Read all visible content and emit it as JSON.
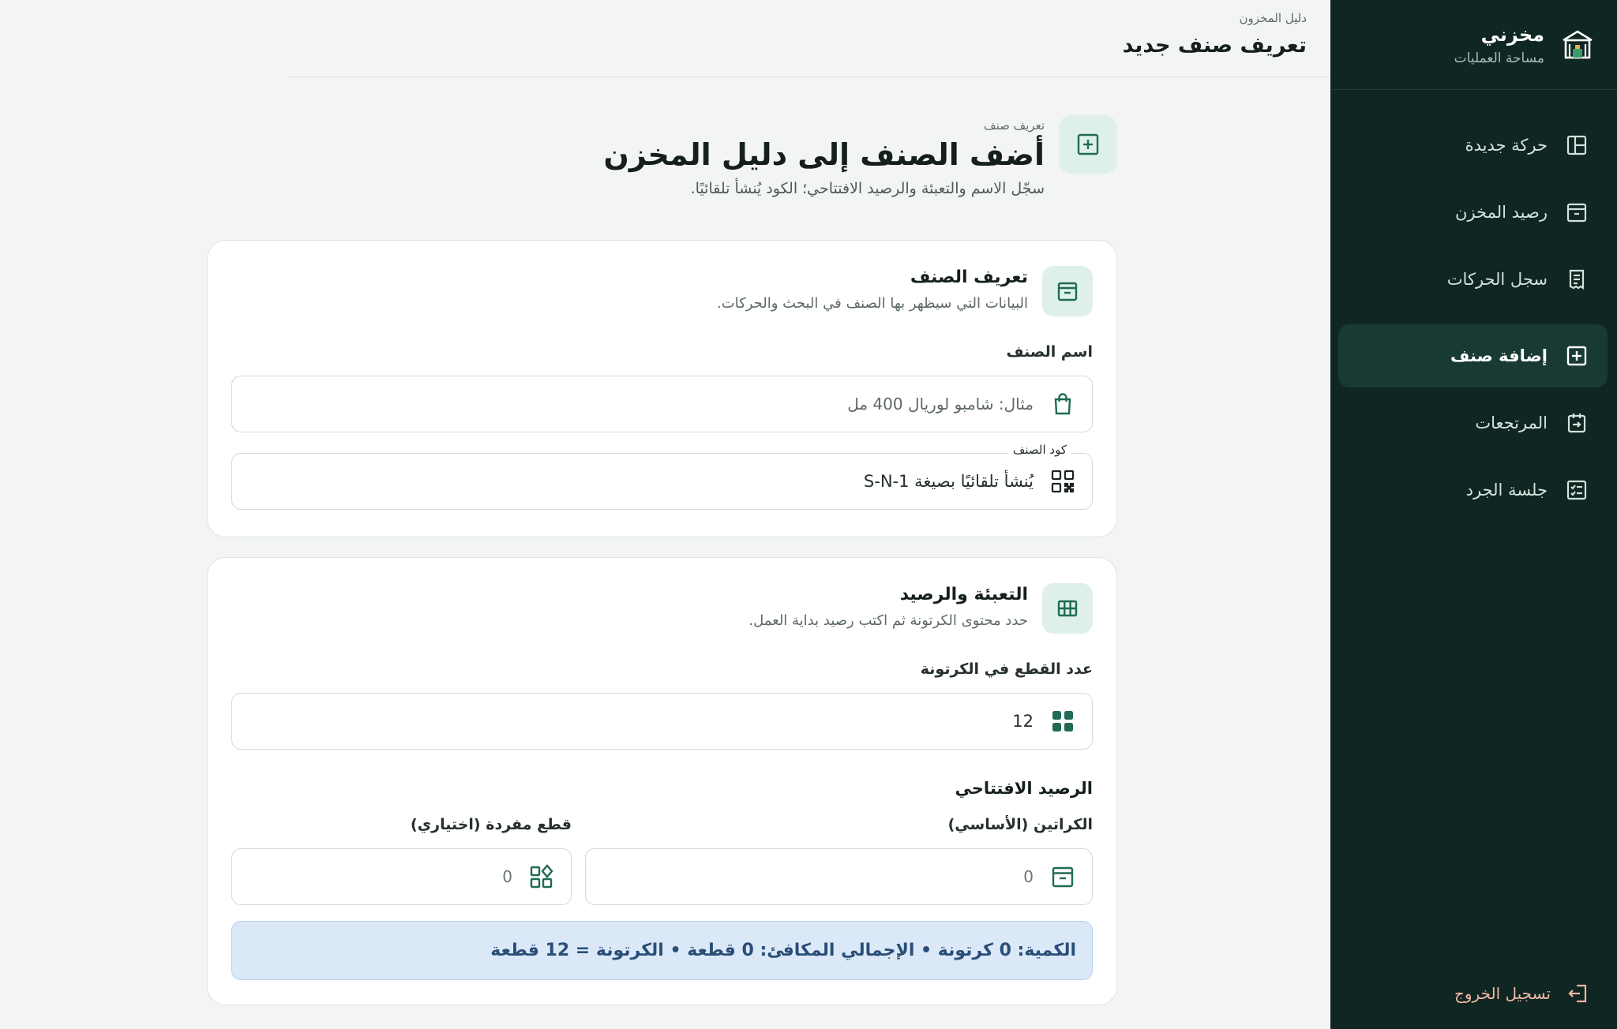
{
  "sidebar": {
    "brand_name": "مخزني",
    "brand_sub": "مساحة العمليات",
    "items": [
      {
        "label": "حركة جديدة",
        "icon": "layout-icon"
      },
      {
        "label": "رصيد المخزن",
        "icon": "archive-icon"
      },
      {
        "label": "سجل الحركات",
        "icon": "receipt-icon"
      },
      {
        "label": "إضافة صنف",
        "icon": "plus-square-icon",
        "active": true
      },
      {
        "label": "المرتجعات",
        "icon": "return-icon"
      },
      {
        "label": "جلسة الجرد",
        "icon": "checklist-icon"
      }
    ],
    "logout": "تسجيل الخروج"
  },
  "topbar": {
    "breadcrumb": "دليل المخزون",
    "title": "تعريف صنف جديد"
  },
  "heading": {
    "eyebrow": "تعريف صنف",
    "title": "أضف الصنف إلى دليل المخزن",
    "subtitle": "سجّل الاسم والتعبئة والرصيد الافتتاحي؛ الكود يُنشأ تلقائيًا."
  },
  "card_definition": {
    "title": "تعريف الصنف",
    "description": "البيانات التي سيظهر بها الصنف في البحث والحركات.",
    "name_label": "اسم الصنف",
    "name_placeholder": "مثال: شامبو لوريال 400 مل",
    "code_label": "كود الصنف",
    "code_value": "يُنشأ تلقائيًا بصيغة S-N-1"
  },
  "card_packing": {
    "title": "التعبئة والرصيد",
    "description": "حدد محتوى الكرتونة ثم اكتب رصيد بداية العمل.",
    "pieces_label": "عدد القطع في الكرتونة",
    "pieces_value": "12",
    "opening_title": "الرصيد الافتتاحي",
    "cartons_label": "الكراتين (الأساسي)",
    "cartons_value": "0",
    "singles_label": "قطع مفردة (اختياري)",
    "singles_value": "0",
    "summary": "الكمية: 0 كرتونة • الإجمالي المكافئ: 0 قطعة • الكرتونة = 12 قطعة"
  },
  "colors": {
    "sidebar_bg": "#102622",
    "accent": "#1f6b55",
    "summary_bg": "#dbe8f7",
    "summary_text": "#294e78"
  }
}
